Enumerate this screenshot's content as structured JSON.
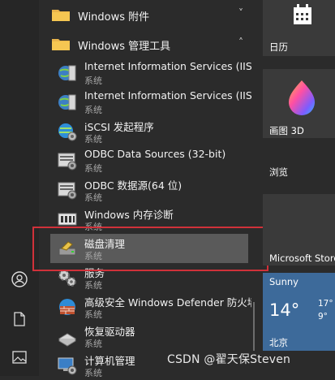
{
  "folders": [
    {
      "label": "Windows 附件",
      "chevron": "˅"
    },
    {
      "label": "Windows 管理工具",
      "chevron": "˄"
    }
  ],
  "items": [
    {
      "name": "Internet Information Services (IIS)...",
      "sub": "系统",
      "icon": "iis-icon"
    },
    {
      "name": "Internet Information Services (IIS)...",
      "sub": "系统",
      "icon": "iis-icon"
    },
    {
      "name": "iSCSI 发起程序",
      "sub": "系统",
      "icon": "globe-gear-icon"
    },
    {
      "name": "ODBC Data Sources (32-bit)",
      "sub": "系统",
      "icon": "odbc-icon"
    },
    {
      "name": "ODBC 数据源(64 位)",
      "sub": "系统",
      "icon": "odbc-icon"
    },
    {
      "name": "Windows 内存诊断",
      "sub": "系统",
      "icon": "memory-chip-icon"
    },
    {
      "name": "磁盘清理",
      "sub": "系统",
      "icon": "disk-cleanup-icon"
    },
    {
      "name": "服务",
      "sub": "系统",
      "icon": "gears-icon"
    },
    {
      "name": "高级安全 Windows Defender 防火墙",
      "sub": "系统",
      "icon": "firewall-icon"
    },
    {
      "name": "恢复驱动器",
      "sub": "系统",
      "icon": "recovery-drive-icon"
    },
    {
      "name": "计算机管理",
      "sub": "系统",
      "icon": "computer-management-icon"
    }
  ],
  "tiles": {
    "calendar": "日历",
    "paint3d": "画图 3D",
    "group_browse": "浏览",
    "store": "Microsoft Store",
    "weather": {
      "condition": "Sunny",
      "temp": "14°",
      "high": "17°",
      "low": "9°",
      "city": "北京"
    }
  },
  "watermark": "CSDN @翟天保Steven",
  "colors": {
    "accent_red": "#d0313a",
    "selected_bg": "#5a5a5a",
    "weather_bg": "#3d6a9a"
  }
}
